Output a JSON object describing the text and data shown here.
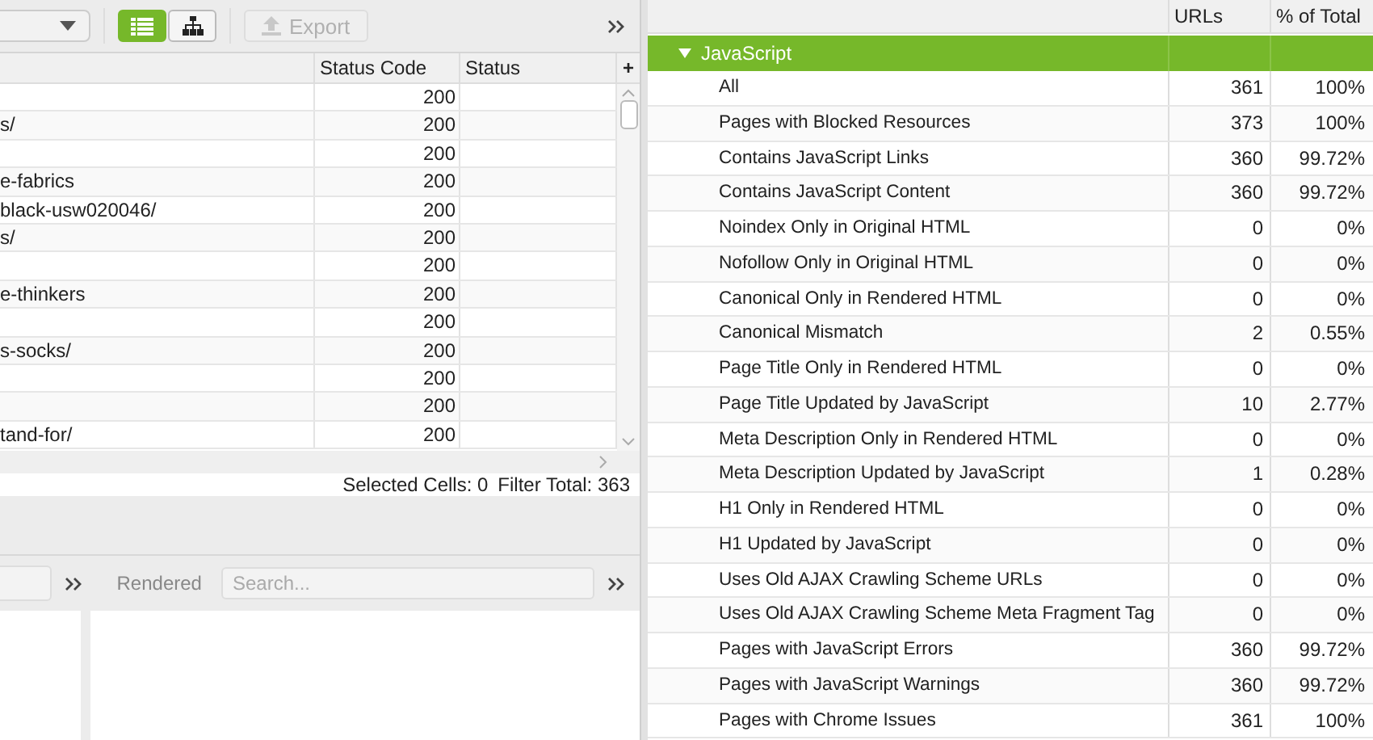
{
  "left_toolbar": {
    "view_toggle": [
      {
        "kind": "list",
        "selected": true
      },
      {
        "kind": "tree",
        "selected": false
      }
    ],
    "export_button": {
      "label": "Export",
      "disabled": true
    }
  },
  "url_table": {
    "columns": [
      "Status Code",
      "Status"
    ],
    "add_column": "+",
    "rows": [
      {
        "status_code": "200"
      },
      {
        "url": "s/",
        "status_code": "200"
      },
      {
        "status_code": "200"
      },
      {
        "url": "e-fabrics",
        "status_code": "200"
      },
      {
        "url": "black-usw020046/",
        "status_code": "200"
      },
      {
        "url": "s/",
        "status_code": "200"
      },
      {
        "status_code": "200"
      },
      {
        "url": "e-thinkers",
        "status_code": "200"
      },
      {
        "status_code": "200"
      },
      {
        "url": "s-socks/",
        "status_code": "200"
      },
      {
        "status_code": "200"
      },
      {
        "status_code": "200"
      },
      {
        "url": "tand-for/",
        "status_code": "200"
      }
    ]
  },
  "status_bar": {
    "selected_cells": "Selected Cells: 0",
    "filter_total": "Filter Total: 363"
  },
  "bottom_panel": {
    "view_label": "Rendered",
    "search": {
      "placeholder": "Search..."
    }
  },
  "overview": {
    "columns": [
      "URLs",
      "% of Total"
    ],
    "section": {
      "label": "JavaScript",
      "expanded": true
    },
    "rows": [
      {
        "label": "All",
        "urls": "361",
        "percent": "100%"
      },
      {
        "label": "Pages with Blocked Resources",
        "urls": "373",
        "percent": "100%"
      },
      {
        "label": "Contains JavaScript Links",
        "urls": "360",
        "percent": "99.72%"
      },
      {
        "label": "Contains JavaScript Content",
        "urls": "360",
        "percent": "99.72%"
      },
      {
        "label": "Noindex Only in Original HTML",
        "urls": "0",
        "percent": "0%"
      },
      {
        "label": "Nofollow Only in Original HTML",
        "urls": "0",
        "percent": "0%"
      },
      {
        "label": "Canonical Only in Rendered HTML",
        "urls": "0",
        "percent": "0%"
      },
      {
        "label": "Canonical Mismatch",
        "urls": "2",
        "percent": "0.55%"
      },
      {
        "label": "Page Title Only in Rendered HTML",
        "urls": "0",
        "percent": "0%"
      },
      {
        "label": "Page Title Updated by JavaScript",
        "urls": "10",
        "percent": "2.77%"
      },
      {
        "label": "Meta Description Only in Rendered HTML",
        "urls": "0",
        "percent": "0%"
      },
      {
        "label": "Meta Description Updated by JavaScript",
        "urls": "1",
        "percent": "0.28%"
      },
      {
        "label": "H1 Only in Rendered HTML",
        "urls": "0",
        "percent": "0%"
      },
      {
        "label": "H1 Updated by JavaScript",
        "urls": "0",
        "percent": "0%"
      },
      {
        "label": "Uses Old AJAX Crawling Scheme URLs",
        "urls": "0",
        "percent": "0%"
      },
      {
        "label": "Uses Old AJAX Crawling Scheme Meta Fragment Tag",
        "urls": "0",
        "percent": "0%"
      },
      {
        "label": "Pages with JavaScript Errors",
        "urls": "360",
        "percent": "99.72%"
      },
      {
        "label": "Pages with JavaScript Warnings",
        "urls": "360",
        "percent": "99.72%"
      },
      {
        "label": "Pages with Chrome Issues",
        "urls": "361",
        "percent": "100%"
      }
    ]
  }
}
